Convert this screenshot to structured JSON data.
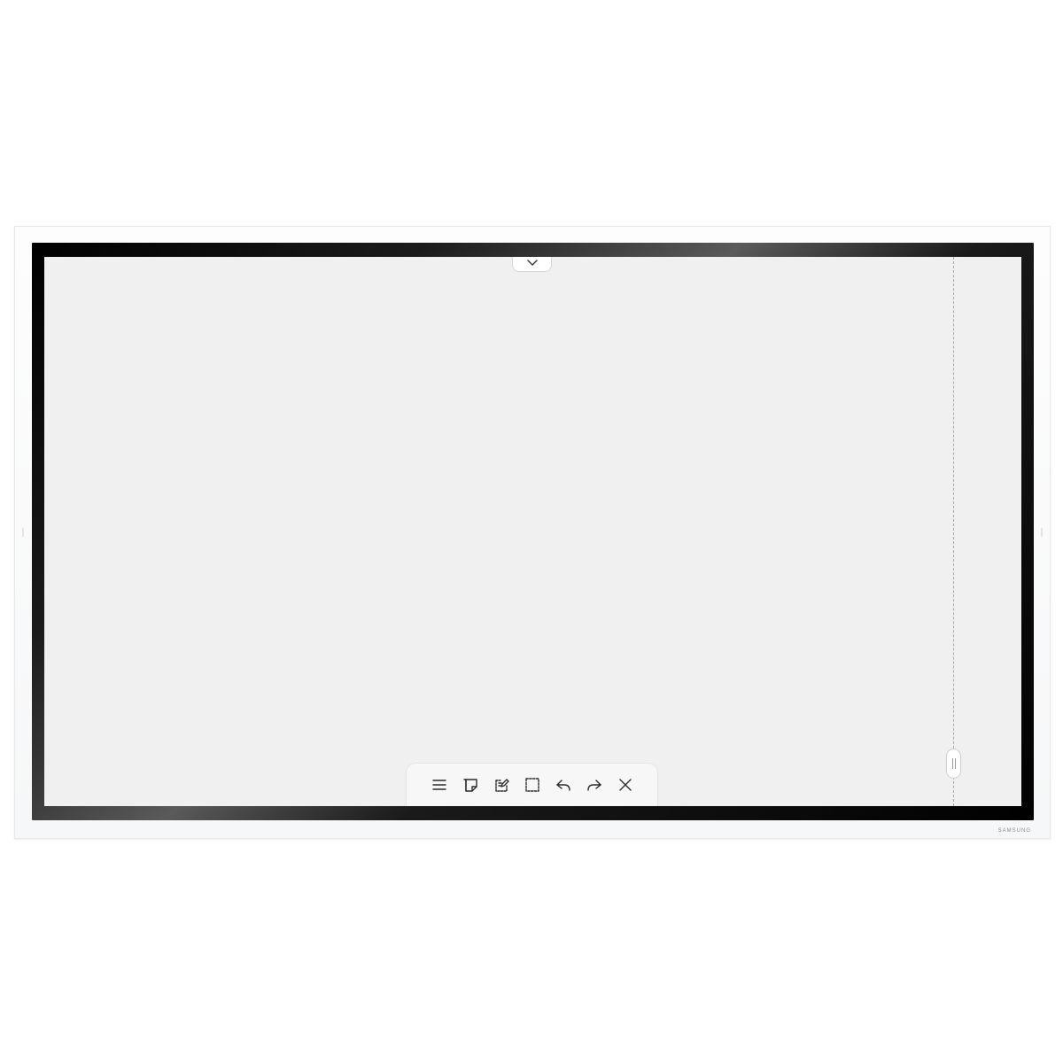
{
  "device": {
    "brand": "SAMSUNG"
  },
  "top_handle": {
    "icon": "chevron-down-icon"
  },
  "toolbar": {
    "items": [
      {
        "name": "menu-button",
        "icon": "menu-icon"
      },
      {
        "name": "note-button",
        "icon": "sticky-note-icon"
      },
      {
        "name": "edit-page-button",
        "icon": "edit-page-icon"
      },
      {
        "name": "select-button",
        "icon": "selection-box-icon"
      },
      {
        "name": "undo-button",
        "icon": "undo-icon"
      },
      {
        "name": "redo-button",
        "icon": "redo-icon"
      },
      {
        "name": "close-button",
        "icon": "close-icon"
      }
    ]
  },
  "colors": {
    "screen": "#f0f0f0",
    "bezel": "#000000",
    "frame": "#fdfdfd",
    "icon": "#2b2b2b"
  }
}
